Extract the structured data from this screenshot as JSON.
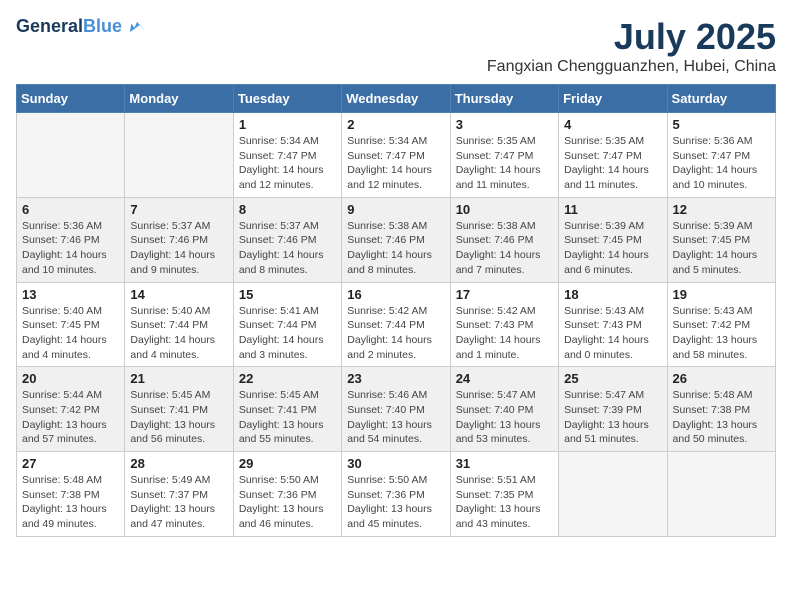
{
  "header": {
    "logo_line1": "General",
    "logo_line2": "Blue",
    "month": "July 2025",
    "location": "Fangxian Chengguanzhen, Hubei, China"
  },
  "days_of_week": [
    "Sunday",
    "Monday",
    "Tuesday",
    "Wednesday",
    "Thursday",
    "Friday",
    "Saturday"
  ],
  "weeks": [
    [
      {
        "day": "",
        "sunrise": "",
        "sunset": "",
        "daylight": ""
      },
      {
        "day": "",
        "sunrise": "",
        "sunset": "",
        "daylight": ""
      },
      {
        "day": "1",
        "sunrise": "Sunrise: 5:34 AM",
        "sunset": "Sunset: 7:47 PM",
        "daylight": "Daylight: 14 hours and 12 minutes."
      },
      {
        "day": "2",
        "sunrise": "Sunrise: 5:34 AM",
        "sunset": "Sunset: 7:47 PM",
        "daylight": "Daylight: 14 hours and 12 minutes."
      },
      {
        "day": "3",
        "sunrise": "Sunrise: 5:35 AM",
        "sunset": "Sunset: 7:47 PM",
        "daylight": "Daylight: 14 hours and 11 minutes."
      },
      {
        "day": "4",
        "sunrise": "Sunrise: 5:35 AM",
        "sunset": "Sunset: 7:47 PM",
        "daylight": "Daylight: 14 hours and 11 minutes."
      },
      {
        "day": "5",
        "sunrise": "Sunrise: 5:36 AM",
        "sunset": "Sunset: 7:47 PM",
        "daylight": "Daylight: 14 hours and 10 minutes."
      }
    ],
    [
      {
        "day": "6",
        "sunrise": "Sunrise: 5:36 AM",
        "sunset": "Sunset: 7:46 PM",
        "daylight": "Daylight: 14 hours and 10 minutes."
      },
      {
        "day": "7",
        "sunrise": "Sunrise: 5:37 AM",
        "sunset": "Sunset: 7:46 PM",
        "daylight": "Daylight: 14 hours and 9 minutes."
      },
      {
        "day": "8",
        "sunrise": "Sunrise: 5:37 AM",
        "sunset": "Sunset: 7:46 PM",
        "daylight": "Daylight: 14 hours and 8 minutes."
      },
      {
        "day": "9",
        "sunrise": "Sunrise: 5:38 AM",
        "sunset": "Sunset: 7:46 PM",
        "daylight": "Daylight: 14 hours and 8 minutes."
      },
      {
        "day": "10",
        "sunrise": "Sunrise: 5:38 AM",
        "sunset": "Sunset: 7:46 PM",
        "daylight": "Daylight: 14 hours and 7 minutes."
      },
      {
        "day": "11",
        "sunrise": "Sunrise: 5:39 AM",
        "sunset": "Sunset: 7:45 PM",
        "daylight": "Daylight: 14 hours and 6 minutes."
      },
      {
        "day": "12",
        "sunrise": "Sunrise: 5:39 AM",
        "sunset": "Sunset: 7:45 PM",
        "daylight": "Daylight: 14 hours and 5 minutes."
      }
    ],
    [
      {
        "day": "13",
        "sunrise": "Sunrise: 5:40 AM",
        "sunset": "Sunset: 7:45 PM",
        "daylight": "Daylight: 14 hours and 4 minutes."
      },
      {
        "day": "14",
        "sunrise": "Sunrise: 5:40 AM",
        "sunset": "Sunset: 7:44 PM",
        "daylight": "Daylight: 14 hours and 4 minutes."
      },
      {
        "day": "15",
        "sunrise": "Sunrise: 5:41 AM",
        "sunset": "Sunset: 7:44 PM",
        "daylight": "Daylight: 14 hours and 3 minutes."
      },
      {
        "day": "16",
        "sunrise": "Sunrise: 5:42 AM",
        "sunset": "Sunset: 7:44 PM",
        "daylight": "Daylight: 14 hours and 2 minutes."
      },
      {
        "day": "17",
        "sunrise": "Sunrise: 5:42 AM",
        "sunset": "Sunset: 7:43 PM",
        "daylight": "Daylight: 14 hours and 1 minute."
      },
      {
        "day": "18",
        "sunrise": "Sunrise: 5:43 AM",
        "sunset": "Sunset: 7:43 PM",
        "daylight": "Daylight: 14 hours and 0 minutes."
      },
      {
        "day": "19",
        "sunrise": "Sunrise: 5:43 AM",
        "sunset": "Sunset: 7:42 PM",
        "daylight": "Daylight: 13 hours and 58 minutes."
      }
    ],
    [
      {
        "day": "20",
        "sunrise": "Sunrise: 5:44 AM",
        "sunset": "Sunset: 7:42 PM",
        "daylight": "Daylight: 13 hours and 57 minutes."
      },
      {
        "day": "21",
        "sunrise": "Sunrise: 5:45 AM",
        "sunset": "Sunset: 7:41 PM",
        "daylight": "Daylight: 13 hours and 56 minutes."
      },
      {
        "day": "22",
        "sunrise": "Sunrise: 5:45 AM",
        "sunset": "Sunset: 7:41 PM",
        "daylight": "Daylight: 13 hours and 55 minutes."
      },
      {
        "day": "23",
        "sunrise": "Sunrise: 5:46 AM",
        "sunset": "Sunset: 7:40 PM",
        "daylight": "Daylight: 13 hours and 54 minutes."
      },
      {
        "day": "24",
        "sunrise": "Sunrise: 5:47 AM",
        "sunset": "Sunset: 7:40 PM",
        "daylight": "Daylight: 13 hours and 53 minutes."
      },
      {
        "day": "25",
        "sunrise": "Sunrise: 5:47 AM",
        "sunset": "Sunset: 7:39 PM",
        "daylight": "Daylight: 13 hours and 51 minutes."
      },
      {
        "day": "26",
        "sunrise": "Sunrise: 5:48 AM",
        "sunset": "Sunset: 7:38 PM",
        "daylight": "Daylight: 13 hours and 50 minutes."
      }
    ],
    [
      {
        "day": "27",
        "sunrise": "Sunrise: 5:48 AM",
        "sunset": "Sunset: 7:38 PM",
        "daylight": "Daylight: 13 hours and 49 minutes."
      },
      {
        "day": "28",
        "sunrise": "Sunrise: 5:49 AM",
        "sunset": "Sunset: 7:37 PM",
        "daylight": "Daylight: 13 hours and 47 minutes."
      },
      {
        "day": "29",
        "sunrise": "Sunrise: 5:50 AM",
        "sunset": "Sunset: 7:36 PM",
        "daylight": "Daylight: 13 hours and 46 minutes."
      },
      {
        "day": "30",
        "sunrise": "Sunrise: 5:50 AM",
        "sunset": "Sunset: 7:36 PM",
        "daylight": "Daylight: 13 hours and 45 minutes."
      },
      {
        "day": "31",
        "sunrise": "Sunrise: 5:51 AM",
        "sunset": "Sunset: 7:35 PM",
        "daylight": "Daylight: 13 hours and 43 minutes."
      },
      {
        "day": "",
        "sunrise": "",
        "sunset": "",
        "daylight": ""
      },
      {
        "day": "",
        "sunrise": "",
        "sunset": "",
        "daylight": ""
      }
    ]
  ]
}
